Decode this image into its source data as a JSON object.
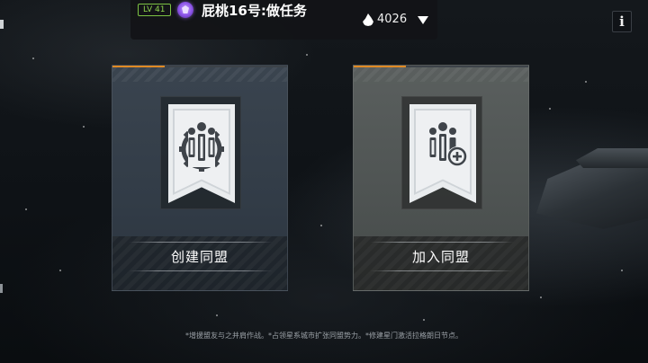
{
  "header": {
    "level_badge": "LV 41",
    "player_name": "屁桃16号:做任务",
    "power_value": "4026",
    "rank_icon": "purple-rank-emblem-icon",
    "power_icon": "flame-icon",
    "dropdown_icon": "triangle-down-icon"
  },
  "info_button": {
    "label": "i"
  },
  "cards": [
    {
      "label": "创建同盟",
      "icon": "alliance-gear-banner-icon"
    },
    {
      "label": "加入同盟",
      "icon": "alliance-join-banner-icon"
    }
  ],
  "footer_note": "*增援盟友与之并肩作战。*占领星系城市扩张同盟势力。*修建星门激活拉格朗日节点。",
  "colors": {
    "accent_orange": "#e08a24",
    "level_green": "#8fd44e",
    "rank_purple": "#8a52e6"
  }
}
